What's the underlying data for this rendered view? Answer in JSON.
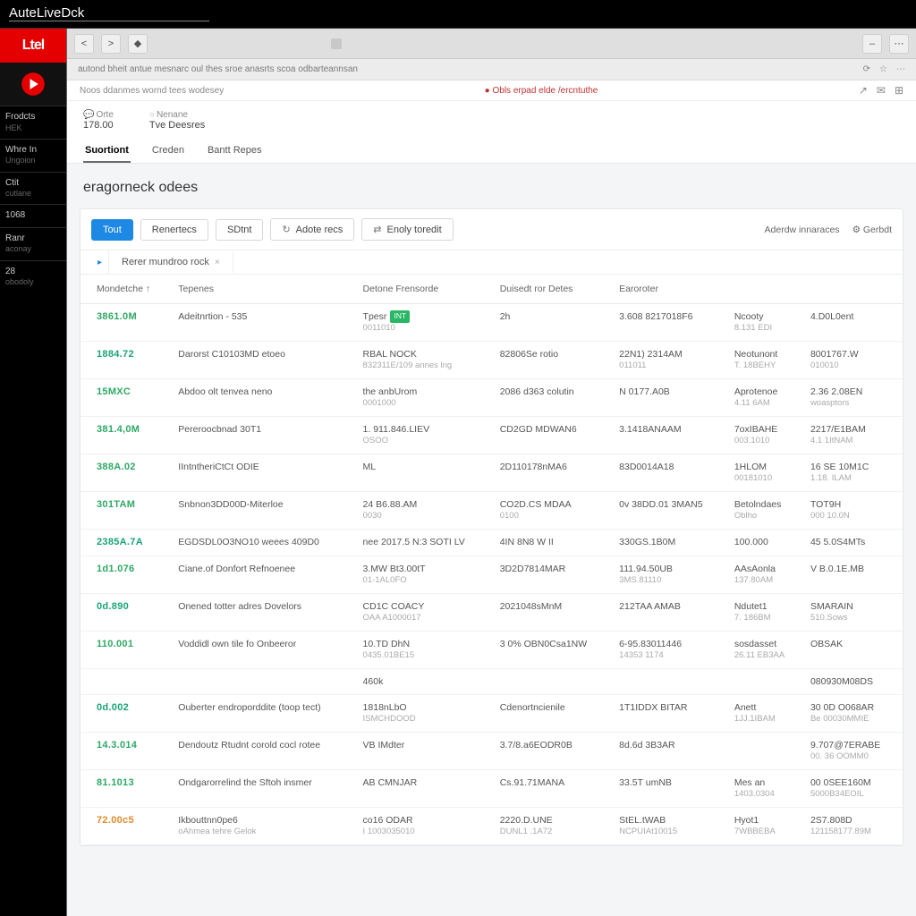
{
  "titlebar": "AuteLiveDck",
  "sidebar": {
    "brand": "Ltel",
    "items": [
      {
        "lbl": "Frodcts",
        "sub": "HEK"
      },
      {
        "lbl": "Whre In",
        "sub": "Ungoion"
      },
      {
        "lbl": "Ctit",
        "sub": "cutlane"
      },
      {
        "lbl": "1068",
        "sub": ""
      },
      {
        "lbl": "Ranr",
        "sub": "aconay"
      },
      {
        "lbl": "28",
        "sub": "obodoly"
      }
    ]
  },
  "toolbar": {
    "back": "<",
    "fwd": ">",
    "shield": "◆"
  },
  "addressline": {
    "text": "autond bheit antue mesnarc oul thes sroe anasrts scoa odbarteannsan",
    "icons": [
      "⟳",
      "☆",
      "⋯"
    ]
  },
  "subheader": {
    "left": "Noos ddanmes wornd tees wodesey",
    "warn": "● Obls erpad elde /ercntuthe",
    "icons": [
      "↗",
      "✉",
      "⊞"
    ]
  },
  "stats": [
    {
      "lbl": "Orte",
      "val": "178.00",
      "pre": "💬"
    },
    {
      "lbl": "Nenane",
      "val": "Tve Deesres",
      "pre": "○"
    }
  ],
  "innertabs": [
    {
      "label": "Suortiont",
      "active": true
    },
    {
      "label": "Creden",
      "active": false
    },
    {
      "label": "Bantt Repes",
      "active": false
    }
  ],
  "page_title": "eragorneck odees",
  "actionbar": {
    "primary": "Tout",
    "buttons": [
      "Renertecs",
      "SDtnt"
    ],
    "iconbuttons": [
      {
        "icon": "↻",
        "label": "Adote recs"
      },
      {
        "icon": "⇄",
        "label": "Enoly toredit"
      }
    ],
    "rightlinks": [
      "Aderdw innaraces",
      "⚙ Gerbdt"
    ]
  },
  "subtab": {
    "label": "Rerer mundroo rock",
    "close": "×",
    "sq": "▸"
  },
  "columns": [
    "Mondetche ↑",
    "Tepenes",
    "Detone Frensorde",
    "Duisedt ror Detes",
    "Earoroter",
    "",
    ""
  ],
  "rows": [
    {
      "id": "3861.0M",
      "cls": "green",
      "c1": "Adeitnrtion - 535",
      "c2": "Tpesr",
      "badge": "INT",
      "c2s": "0011010",
      "c3": "2h",
      "c4": "3.608 8217018F6",
      "c5": "Ncooty",
      "c5s": "8.131 EDI",
      "c6": "4.D0L0ent",
      "c6s": ""
    },
    {
      "id": "1884.72",
      "cls": "teal",
      "c1": "Darorst C10103MD etoeo",
      "c2": "RBAL NOCK",
      "c2s": "832311E/109 annes lng",
      "c3": "82806Se rotio",
      "c4": "22N1) 2314AM",
      "c4s": "011011",
      "c5": "Neotunont",
      "c5s": "T. 18BEHY",
      "c6": "8001767.W",
      "c6s": "010010"
    },
    {
      "id": "15MXC",
      "cls": "green",
      "c1": "Abdoo olt tenvea neno",
      "c2": "the anbUrom",
      "c2s": "0001000",
      "c3": "2086 d363 colutin",
      "c4": "N 0177.A0B",
      "c5": "Aprotenoe",
      "c5s": "4.11 6AM",
      "c6": "2.36 2.08EN",
      "c6s": "woasptors"
    },
    {
      "id": "381.4,0M",
      "cls": "green",
      "c1": "Pereroocbnad 30T1",
      "c2": "1. 911.846.LIEV",
      "c2s": "OSOO",
      "c3": "CD2GD MDWAN6",
      "c4": "3.1418ANAAM",
      "c5": "7oxIBAHE",
      "c5s": "003.1010",
      "c6": "2217/E1BAM",
      "c6s": "4.1 1ItNAM"
    },
    {
      "id": "388A.02",
      "cls": "green",
      "c1": "IIntntheriCtCt ODIE",
      "c2": "ML",
      "c2s": "",
      "c3": "2D110178nMA6",
      "c4": "83D0014A18",
      "c5": "1HLOM",
      "c5s": "00181010",
      "c6": "16 SE 10M1C",
      "c6s": "1.18. ILAM"
    },
    {
      "id": "301TAM",
      "cls": "green",
      "c1": "Snbnon3DD00D-Miterloe",
      "c2": "24 B6.88.AM",
      "c2s": "0030",
      "c3": "CO2D.CS MDAA",
      "c3s": "0100",
      "c4": "0v 38DD.01 3MAN5",
      "c5": "Betolndaes",
      "c5s": "Oblho",
      "c6": "TOT9H",
      "c6s": "000 10.0N"
    },
    {
      "id": "2385A.7A",
      "cls": "teal",
      "c1": "EGDSDL0O3NO10 weees 409D0",
      "c2": "nee 2017.5 N:3 SOTI LV",
      "c2s": "",
      "c3": "4IN 8N8 W II",
      "c4": "330GS.1B0M",
      "c5": "100.000",
      "c5s": "",
      "c6": "45 5.0S4MTs",
      "c6s": ""
    },
    {
      "id": "1d1.076",
      "cls": "green",
      "c1": "Ciane.of Donfort Refnoenee",
      "c2": "3.MW Bt3.00tT",
      "c2s": "01-1AL0FO",
      "c3": "3D2D7814MAR",
      "c4": "111.94.50UB",
      "c4s": "3MS.81110",
      "c5": "AAsAonla",
      "c5s": "137.80AM",
      "c6": "V B.0.1E.MB",
      "c6s": ""
    },
    {
      "id": "0d.890",
      "cls": "teal",
      "c1": "Onened totter adres Dovelors",
      "c2": "CD1C COACY",
      "c2s": "OAA A1000017",
      "c3": "2021048sMnM",
      "c4": "212TAA AMAB",
      "c5": "Ndutet1",
      "c5s": "7. 186BM",
      "c6": "SMARAIN",
      "c6s": "510.Sows"
    },
    {
      "id": "110.001",
      "cls": "green",
      "c1": "Voddidl own tile fo Onbeeror",
      "c2": "10.TD DhN",
      "c2s": "0435.01BE15",
      "c3": "3 0% OBN0Csa1NW",
      "c4": "6-95.83011446",
      "c4s": "14353 1174",
      "c5": "sosdasset",
      "c5s": "26.11 EB3AA",
      "c6": "OBSAK",
      "c6s": ""
    },
    {
      "id": "",
      "cls": "",
      "c1": "",
      "c2": "460k",
      "c2s": "",
      "c3": "",
      "c4": "",
      "c5": "",
      "c6": "080930M08DS",
      "c6s": ""
    },
    {
      "id": "0d.002",
      "cls": "teal",
      "c1": "Ouberter endroporddite (toop tect)",
      "c2": "1818nLbO",
      "c2s": "ISMCHDOOD",
      "c3": "Cdenortncienile",
      "c4": "1T1IDDX BITAR",
      "c5": "Anett",
      "c5s": "1JJ.1IBAM",
      "c6": "30 0D O068AR",
      "c6s": "Be 00030MMIE"
    },
    {
      "id": "14.3.014",
      "cls": "green",
      "c1": "Dendoutz Rtudnt corold cocl rotee",
      "c2": "VB IMdter",
      "c2s": "",
      "c3": "3.7/8.a6EODR0B",
      "c4": "8d.6d 3B3AR",
      "c5": "",
      "c5s": "",
      "c6": "9.707@7ERABE",
      "c6s": "00. 36 OOMM0"
    },
    {
      "id": "81.1013",
      "cls": "green",
      "c1": "Ondgarorrelind the Sftoh insmer",
      "c2": "AB CMNJAR",
      "c2s": "",
      "c3": "Cs.91.71MANA",
      "c4": "33.5T umNB",
      "c5": "Mes an",
      "c5s": "1403.0304",
      "c6": "00 0SEE160M",
      "c6s": "5000B34EOIL"
    },
    {
      "id": "72.00c5",
      "cls": "orange",
      "c1": "Ikbouttnn0pe6",
      "c1s": "oAhmea tehre Gelok",
      "c2": "co16 ODAR",
      "c2s": "I 1003035010",
      "c3": "2220.D.UNE",
      "c3s": "DUNL1 .1A72",
      "c4": "StEL.tWAB",
      "c4s": "NCPUIAt10015",
      "c5": "Hyot1",
      "c5s": "7WBBEBA",
      "c6": "2S7.808D",
      "c6s": "121158177.89M"
    }
  ]
}
